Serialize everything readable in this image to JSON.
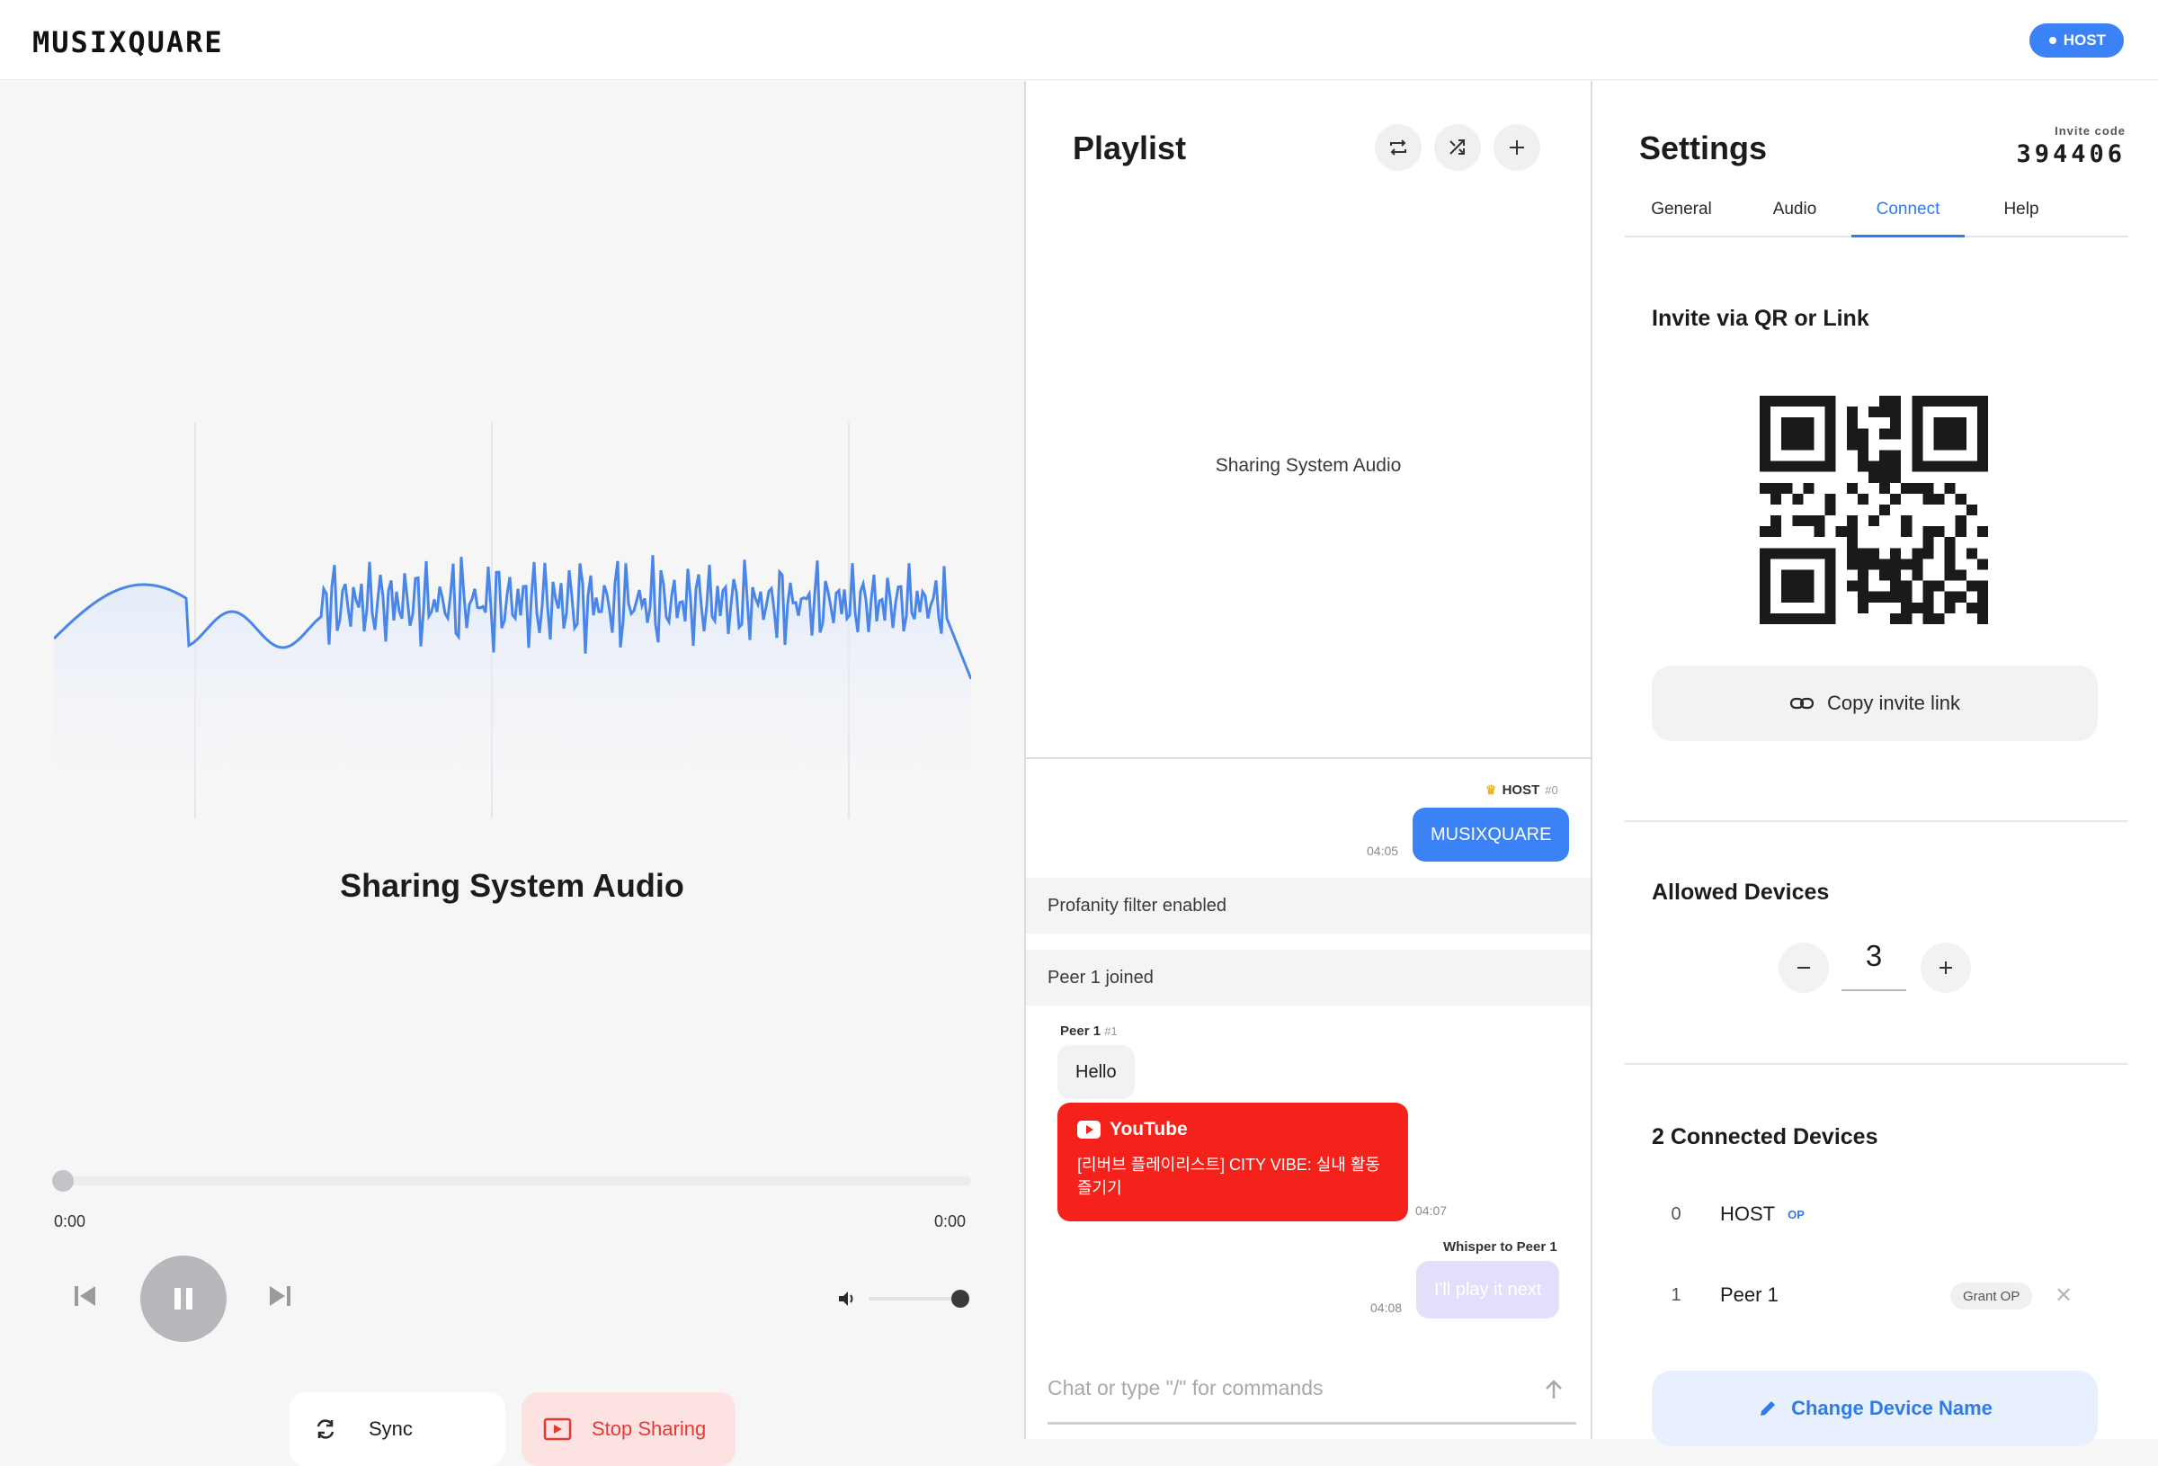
{
  "app": {
    "logo": "MUSIXQUARE",
    "role_badge": "HOST"
  },
  "player": {
    "track_title": "Sharing System Audio",
    "time_current": "0:00",
    "time_total": "0:00",
    "progress": 0,
    "volume": 1.0,
    "state": "playing",
    "sync_label": "Sync",
    "stop_sharing_label": "Stop Sharing"
  },
  "playlist": {
    "title": "Playlist",
    "empty_text": "Sharing System Audio"
  },
  "chat": {
    "host_name": "HOST",
    "host_tag": "#0",
    "host_message": "MUSIXQUARE",
    "host_message_time": "04:05",
    "system_messages": [
      "Profanity filter enabled",
      "Peer 1 joined"
    ],
    "peer_name": "Peer 1",
    "peer_tag": "#1",
    "peer_message": "Hello",
    "youtube_label": "YouTube",
    "youtube_title": "[리버브 플레이리스트] CITY VIBE: 실내 활동 즐기기",
    "youtube_time": "04:07",
    "whisper_label": "Whisper to Peer 1",
    "whisper_message": "I'll play it next",
    "whisper_time": "04:08",
    "input_placeholder": "Chat or type \"/\" for commands"
  },
  "settings": {
    "title": "Settings",
    "invite_code_label": "Invite code",
    "invite_code": "394406",
    "tabs": [
      {
        "label": "General",
        "active": false
      },
      {
        "label": "Audio",
        "active": false
      },
      {
        "label": "Connect",
        "active": true
      },
      {
        "label": "Help",
        "active": false
      }
    ],
    "invite_section_title": "Invite via QR or Link",
    "copy_invite_label": "Copy invite link",
    "allowed_devices_title": "Allowed Devices",
    "allowed_devices_value": "3",
    "connected_title": "2 Connected Devices",
    "devices": [
      {
        "index": "0",
        "name": "HOST",
        "badge": "OP"
      },
      {
        "index": "1",
        "name": "Peer 1",
        "action": "Grant OP"
      }
    ],
    "change_name_label": "Change Device Name"
  },
  "colors": {
    "accent": "#3b82f6",
    "danger": "#e53935",
    "youtube": "#f5221b",
    "whisper": "#e4defa"
  }
}
